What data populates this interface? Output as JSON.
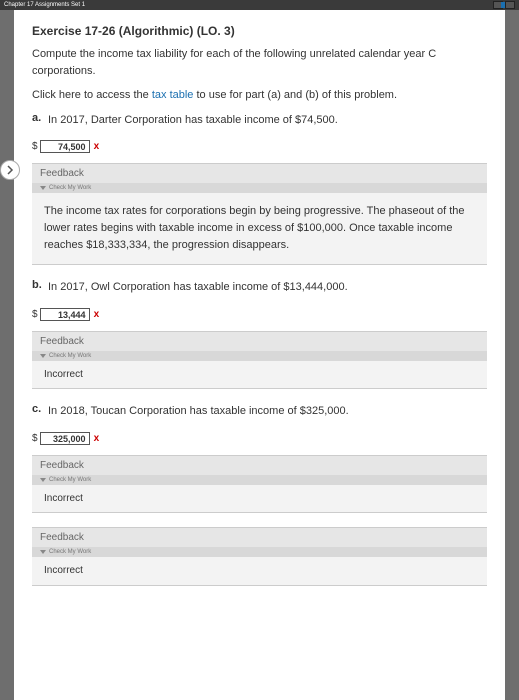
{
  "topbar": {
    "crumbs": "Chapter 17 Assignments  Set 1"
  },
  "side": {
    "label": "Expand"
  },
  "exercise": {
    "title": "Exercise 17-26 (Algorithmic) (LO. 3)",
    "intro": "Compute the income tax liability for each of the following unrelated calendar year C corporations.",
    "link_prefix": "Click here to access the ",
    "link_text": "tax table",
    "link_suffix": " to use for part (a) and (b) of this problem."
  },
  "feedback": {
    "heading": "Feedback",
    "check_label": "Check My Work",
    "incorrect": "Incorrect"
  },
  "parts": {
    "a": {
      "letter": "a.",
      "text": "In 2017, Darter Corporation has taxable income of $74,500.",
      "value": "74,500",
      "mark": "x",
      "fb_text": "The income tax rates for corporations begin by being progressive. The phaseout of the lower rates begins with taxable income in excess of $100,000. Once taxable income reaches $18,333,334, the progression disappears."
    },
    "b": {
      "letter": "b.",
      "text": "In 2017, Owl Corporation has taxable income of $13,444,000.",
      "value": "13,444",
      "mark": "x"
    },
    "c": {
      "letter": "c.",
      "text": "In 2018, Toucan Corporation has taxable income of $325,000.",
      "value": "325,000",
      "mark": "x"
    }
  },
  "dollar": "$"
}
